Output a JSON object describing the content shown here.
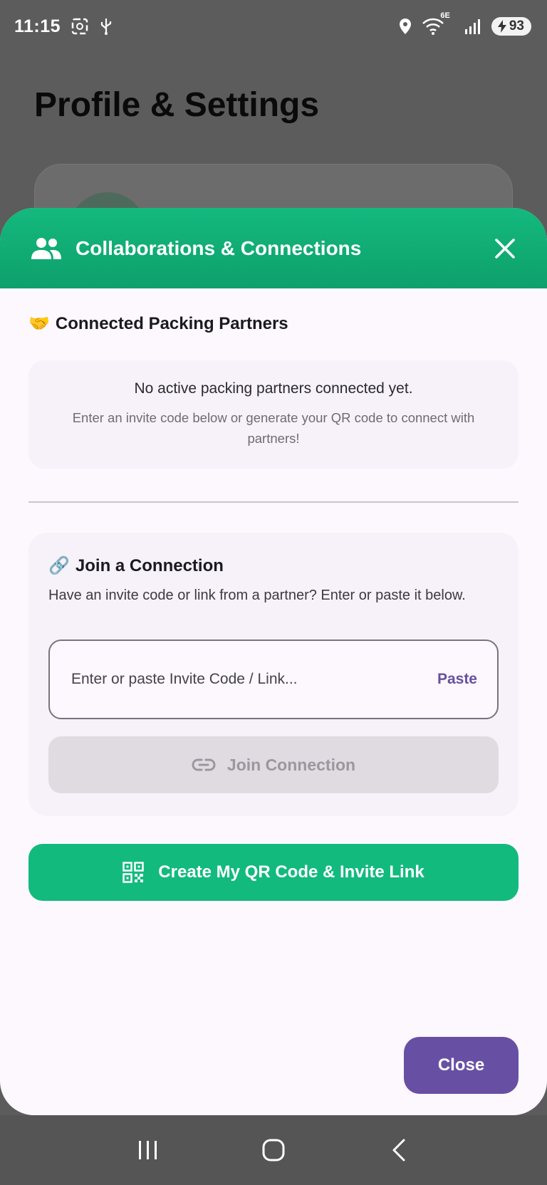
{
  "status_bar": {
    "time": "11:15",
    "network": "6E",
    "battery": "93"
  },
  "background_page": {
    "title": "Profile & Settings"
  },
  "sheet": {
    "header_title": "Collaborations & Connections",
    "partners": {
      "emoji": "🤝",
      "title": "Connected Packing Partners",
      "empty_title": "No active packing partners connected yet.",
      "empty_subtitle": "Enter an invite code below or generate your QR code to connect with partners!"
    },
    "join": {
      "emoji": "🔗",
      "title": "Join a Connection",
      "description": "Have an invite code or link from a partner? Enter or paste it below.",
      "input_placeholder": "Enter or paste Invite Code / Link...",
      "input_value": "",
      "paste_label": "Paste",
      "join_button_label": "Join Connection"
    },
    "qr_button_label": "Create My QR Code & Invite Link",
    "close_button_label": "Close"
  },
  "colors": {
    "accent_green": "#12ba7e",
    "accent_purple": "#6750a4",
    "sheet_bg": "#fdf7fe"
  }
}
